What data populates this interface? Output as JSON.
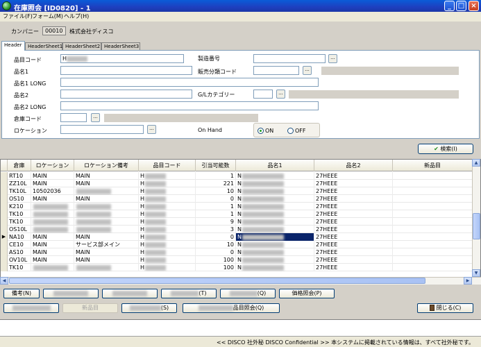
{
  "window": {
    "title": "在庫照会 [ID0820] - 1",
    "min": "_",
    "max": "□",
    "close": "×"
  },
  "menu": [
    "ファイル(F)",
    "フォーム(M)",
    "ヘルプ(H)"
  ],
  "company": {
    "label": "カンパニー",
    "code": "00010",
    "name": "株式会社ディスコ"
  },
  "tabs": [
    "Header",
    "HeaderSheet1",
    "HeaderSheet2",
    "HeaderSheet3"
  ],
  "fields": {
    "item_code": {
      "label": "品目コード",
      "value": "H"
    },
    "item_name1": {
      "label": "品名1",
      "value": ""
    },
    "item_name1_long": {
      "label": "品名1 LONG",
      "value": ""
    },
    "item_name2": {
      "label": "品名2",
      "value": ""
    },
    "item_name2_long": {
      "label": "品名2 LONG",
      "value": ""
    },
    "warehouse_code": {
      "label": "倉庫コード",
      "value": ""
    },
    "location": {
      "label": "ロケーション",
      "value": ""
    },
    "serial_no": {
      "label": "製造番号",
      "value": ""
    },
    "sales_category_code": {
      "label": "販売分類コード",
      "value": ""
    },
    "gl_category": {
      "label": "G/Lカテゴリー",
      "value": ""
    },
    "on_hand": {
      "label": "On Hand",
      "on": "ON",
      "off": "OFF",
      "selected": "ON"
    }
  },
  "ellipsis": "...",
  "search_button": "検索(I)",
  "grid": {
    "columns": [
      "倉庫",
      "ロケーション",
      "ロケーション備考",
      "品目コード",
      "引当可能数",
      "品名1",
      "品名2",
      "新品目"
    ],
    "rows": [
      [
        "RT10",
        "MAIN",
        "MAIN",
        "H",
        "1",
        "N",
        "27HEEE",
        ""
      ],
      [
        "ZZ10L",
        "MAIN",
        "MAIN",
        "H",
        "221",
        "N",
        "27HEEE",
        ""
      ],
      [
        "TK10L",
        "10502036",
        "",
        "H",
        "10",
        "N",
        "27HEEE",
        ""
      ],
      [
        "OS10",
        "MAIN",
        "MAIN",
        "H",
        "0",
        "N",
        "27HEEE",
        ""
      ],
      [
        "K210",
        "",
        "",
        "H",
        "1",
        "N",
        "27HEEE",
        ""
      ],
      [
        "TK10",
        "",
        "",
        "H",
        "1",
        "N",
        "27HEEE",
        ""
      ],
      [
        "TK10",
        "",
        "",
        "H",
        "9",
        "N",
        "27HEEE",
        ""
      ],
      [
        "OS10L",
        "",
        "",
        "H",
        "3",
        "N",
        "27HEEE",
        ""
      ],
      [
        "NA10",
        "MAIN",
        "MAIN",
        "H",
        "0",
        "N",
        "27HEEE",
        ""
      ],
      [
        "CE10",
        "MAIN",
        "サービス部メイン",
        "H",
        "10",
        "N",
        "27HEEE",
        ""
      ],
      [
        "AS10",
        "MAIN",
        "MAIN",
        "H",
        "0",
        "N",
        "27HEEE",
        ""
      ],
      [
        "OV10L",
        "MAIN",
        "MAIN",
        "H",
        "100",
        "N",
        "27HEEE",
        ""
      ],
      [
        "TK10",
        "",
        "",
        "H",
        "100",
        "N",
        "27HEEE",
        ""
      ]
    ],
    "current_row_marker": "▶"
  },
  "buttons": {
    "remarks": "備考(N)",
    "b2": "",
    "b3": "",
    "b4": "(T)",
    "b5": "(Q)",
    "history": "価格照会(P)",
    "b7": "",
    "new_item": "新品目",
    "b9": "(S)",
    "item_inquiry": "品目照会(Q)",
    "close": "閉じる(C)"
  },
  "footer": "<< DISCO 社外秘  DISCO Confidential >> 本システムに掲載されている情報は、すべて社外秘です。"
}
